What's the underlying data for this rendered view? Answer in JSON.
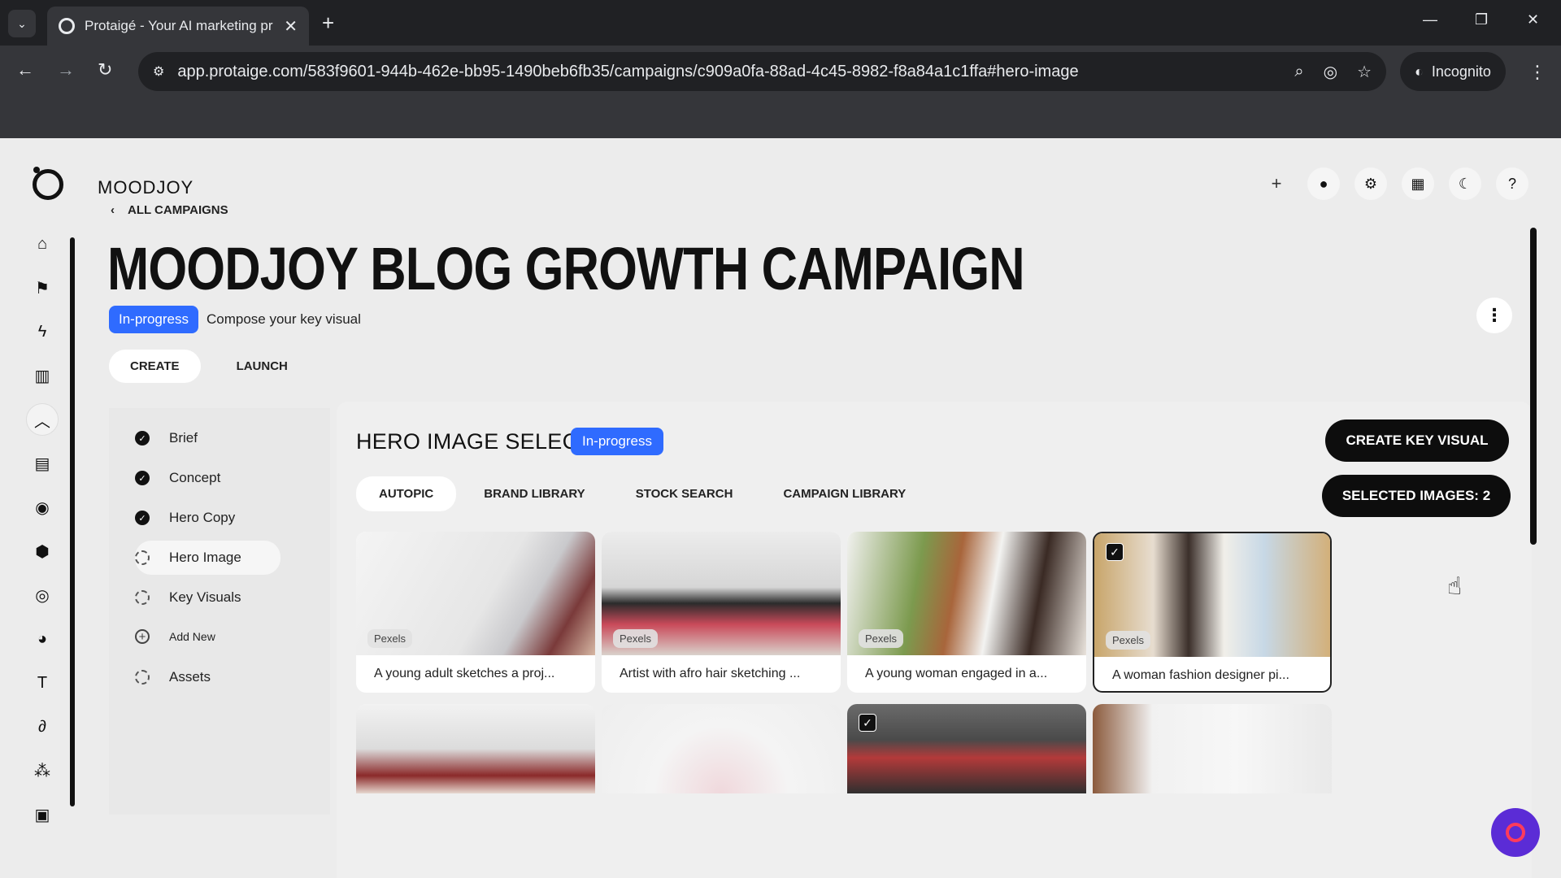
{
  "browser": {
    "tab_title": "Protaigé - Your AI marketing pr",
    "url": "app.protaige.com/583f9601-944b-462e-bb95-1490beb6fb35/campaigns/c909a0fa-88ad-4c45-8982-f8a84a1c1ffa#hero-image",
    "incognito_label": "Incognito"
  },
  "app": {
    "brand": "MOODJOY",
    "top_icons": [
      "plus-icon",
      "user-icon",
      "gear-icon",
      "grid-icon",
      "moon-icon",
      "help-icon"
    ],
    "sidebar_icons": [
      "home-icon",
      "campaign-icon",
      "bolt-icon",
      "book-icon",
      "collapse-icon",
      "document-icon",
      "target-user-icon",
      "box-icon",
      "target-icon",
      "palette-icon",
      "text-icon",
      "signature-icon",
      "people-icon",
      "image-icon"
    ]
  },
  "campaign": {
    "back_label": "ALL CAMPAIGNS",
    "title": "MOODJOY BLOG GROWTH CAMPAIGN",
    "status": "In-progress",
    "status_sub": "Compose your key visual",
    "phases": [
      "CREATE",
      "LAUNCH"
    ]
  },
  "steps": [
    {
      "label": "Brief",
      "state": "done"
    },
    {
      "label": "Concept",
      "state": "done"
    },
    {
      "label": "Hero Copy",
      "state": "done"
    },
    {
      "label": "Hero Image",
      "state": "active"
    },
    {
      "label": "Key Visuals",
      "state": "pending"
    },
    {
      "label": "Add New",
      "state": "add"
    },
    {
      "label": "Assets",
      "state": "pending"
    }
  ],
  "hero": {
    "title": "HERO IMAGE SELECTION",
    "status": "In-progress",
    "tabs": [
      "AUTOPIC",
      "BRAND LIBRARY",
      "STOCK SEARCH",
      "CAMPAIGN LIBRARY"
    ],
    "create_key_visual": "CREATE KEY VISUAL",
    "selected_images": "SELECTED IMAGES: 2",
    "images": [
      {
        "source": "Pexels",
        "caption": "A young adult sketches a proj...",
        "selected": false
      },
      {
        "source": "Pexels",
        "caption": "Artist with afro hair sketching ...",
        "selected": false
      },
      {
        "source": "Pexels",
        "caption": "A young woman engaged in a...",
        "selected": false
      },
      {
        "source": "Pexels",
        "caption": "A woman fashion designer pi...",
        "selected": true
      }
    ]
  },
  "colors": {
    "accent_blue": "#2f6bff",
    "button_black": "#0d0d0d",
    "chat_purple": "#5b2cd6"
  }
}
